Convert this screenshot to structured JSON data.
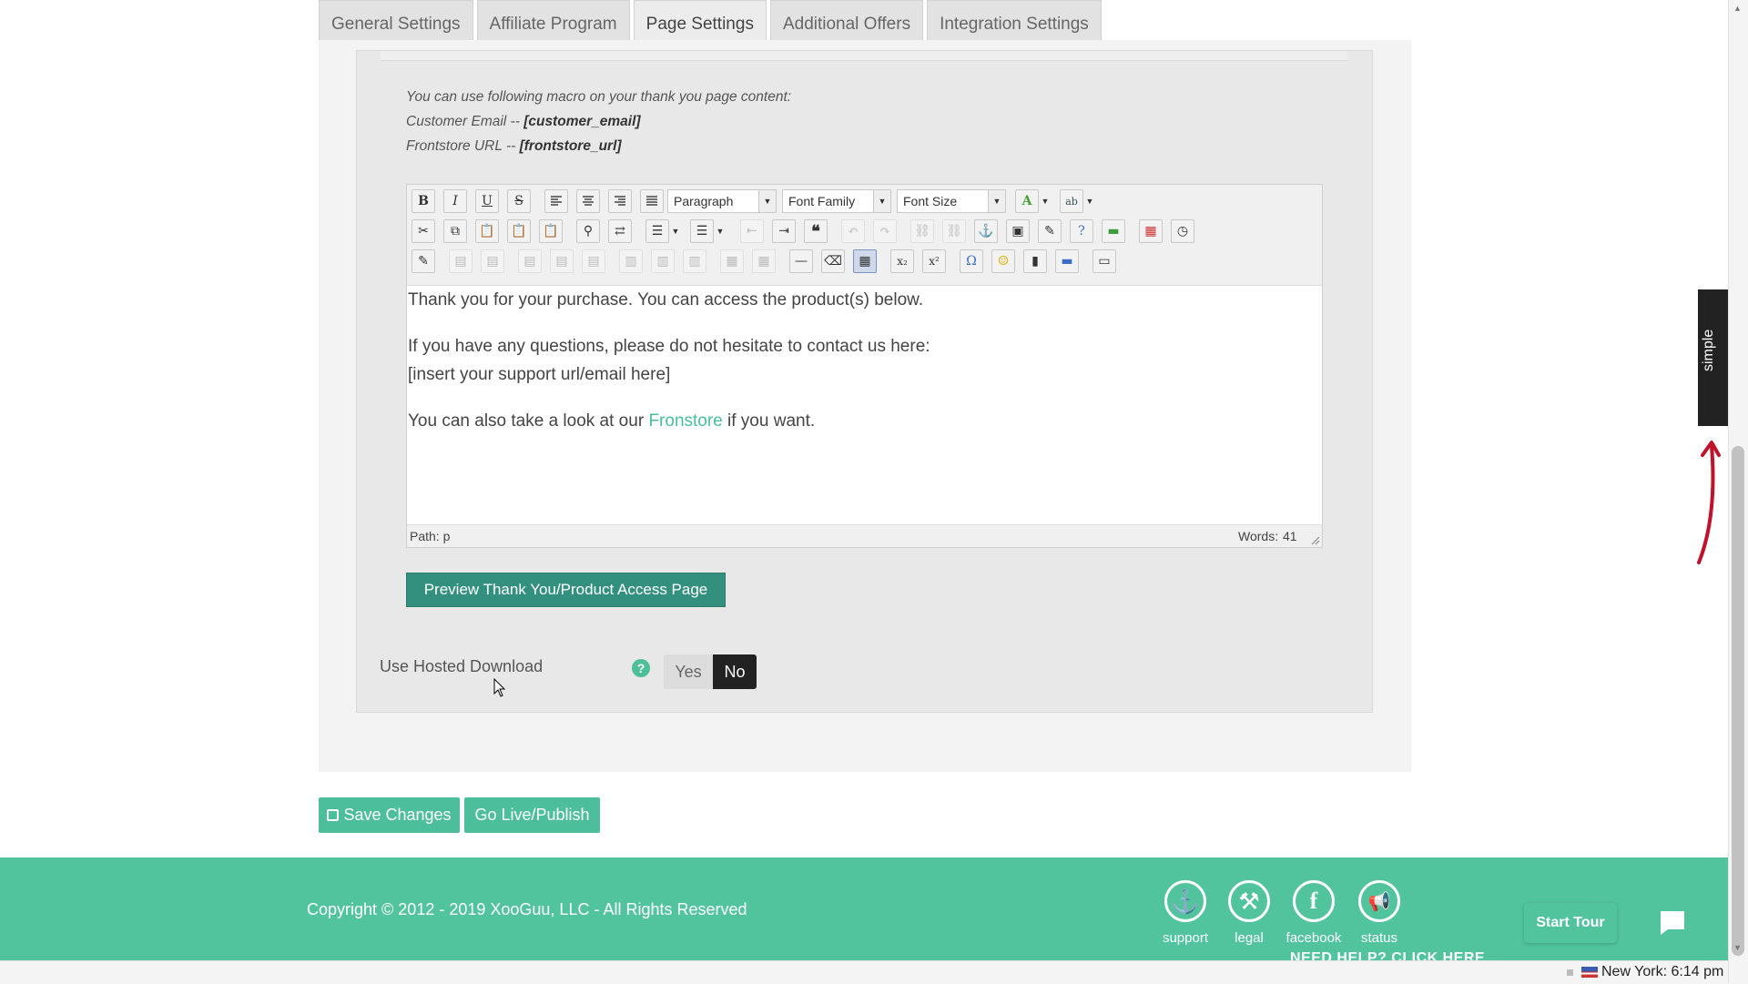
{
  "tabs": [
    {
      "label": "General Settings"
    },
    {
      "label": "Affiliate Program"
    },
    {
      "label": "Page Settings"
    },
    {
      "label": "Additional Offers"
    },
    {
      "label": "Integration Settings"
    }
  ],
  "macros": {
    "intro": "You can use following macro on your thank you page content:",
    "email_label": "Customer Email -- ",
    "email_macro": "[customer_email]",
    "url_label": "Frontstore URL -- ",
    "url_macro": "[frontstore_url]"
  },
  "toolbar": {
    "format_select": "Paragraph",
    "font_family_select": "Font Family",
    "font_size_select": "Font Size",
    "bold": "B",
    "italic": "I",
    "underline": "U",
    "strike": "S",
    "blockquote": "❝",
    "omega": "Ω",
    "subscript": "x₂",
    "superscript": "x²"
  },
  "editor": {
    "line1": "Thank you for your purchase. You can access the product(s) below.",
    "line2": "If you have any questions, please do not hesitate to contact us here:",
    "line3": "[insert your support url/email here]",
    "line4_pre": "You can also take a look at our ",
    "line4_link": "Fronstore",
    "line4_post": " if you want.",
    "path_label": "Path: p",
    "words_label": "Words:",
    "words_count": "41"
  },
  "preview_button": "Preview Thank You/Product Access Page",
  "hosted_download": {
    "label": "Use Hosted Download",
    "help_icon": "?",
    "yes": "Yes",
    "no": "No",
    "selected": "No"
  },
  "actions": {
    "save": "Save Changes",
    "publish": "Go Live/Publish"
  },
  "side_tab": "simple",
  "footer": {
    "copyright": "Copyright © 2012 - 2019 XooGuu, LLC - All Rights Reserved",
    "links": [
      {
        "label": "support",
        "icon": "anchor-icon",
        "glyph": "⚓"
      },
      {
        "label": "legal",
        "icon": "gavel-icon",
        "glyph": "⚒"
      },
      {
        "label": "facebook",
        "icon": "facebook-icon",
        "glyph": "f"
      },
      {
        "label": "status",
        "icon": "megaphone-icon",
        "glyph": "📢"
      }
    ],
    "help_text": "NEED HELP? CLICK HERE",
    "start_tour": "Start Tour"
  },
  "taskbar": {
    "clock": "New York: 6:14 pm"
  },
  "colors": {
    "accent_green": "#52c49d",
    "button_teal": "#34907e",
    "link_green": "#4bbf9b",
    "side_tab": "#222222",
    "arrow_red": "#c0122b"
  }
}
